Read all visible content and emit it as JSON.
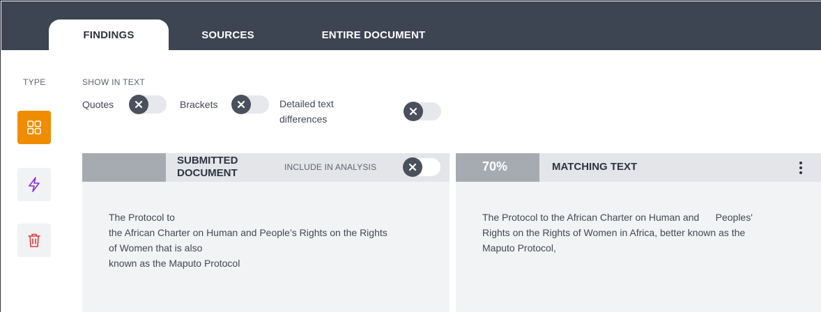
{
  "tabs": [
    {
      "label": "FINDINGS",
      "active": true
    },
    {
      "label": "SOURCES",
      "active": false
    },
    {
      "label": "ENTIRE DOCUMENT",
      "active": false
    }
  ],
  "type_panel": {
    "label": "TYPE",
    "buttons": [
      {
        "icon": "grid-icon",
        "active": true,
        "color": "#f08c00"
      },
      {
        "icon": "lightning-icon",
        "active": false,
        "color": "#8a2be2"
      },
      {
        "icon": "trash-icon",
        "active": false,
        "color": "#e03a3a"
      }
    ]
  },
  "show_in_text": {
    "label": "SHOW IN TEXT",
    "options": [
      {
        "label": "Quotes",
        "enabled": false
      },
      {
        "label": "Brackets",
        "enabled": false
      },
      {
        "label_lines": [
          "Detailed text",
          "differences"
        ],
        "enabled": false
      }
    ]
  },
  "submitted_panel": {
    "title_lines": [
      "SUBMITTED",
      "DOCUMENT"
    ],
    "include_label": "INCLUDE IN ANALYSIS",
    "include_enabled": false,
    "text_lines": [
      "The Protocol to",
      "the African Charter on Human and People’s Rights on the Rights",
      "of Women that is also",
      "known as the Maputo Protocol"
    ]
  },
  "matching_panel": {
    "percent": "70%",
    "title": "MATCHING TEXT",
    "text_lines": [
      "The Protocol to the African Charter on Human and      Peoples'",
      "Rights on the Rights of Women in Africa, better known as the",
      "Maputo Protocol,"
    ]
  },
  "colors": {
    "topbar": "#3d4452",
    "accent": "#f08c00",
    "panel_bg": "#f2f3f5",
    "header_block": "#a6abb2"
  }
}
